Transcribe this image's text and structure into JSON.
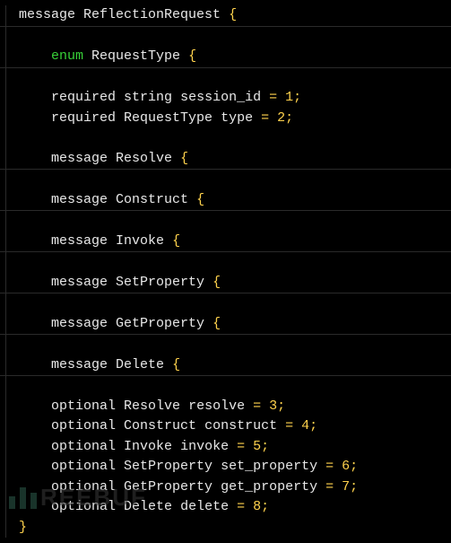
{
  "lines": {
    "l0": "message ReflectionRequest {",
    "l1": "    enum RequestType {",
    "l2": "    required string session_id = 1;",
    "l3": "    required RequestType type = 2;",
    "l4": "    message Resolve {",
    "l5": "    message Construct {",
    "l6": "    message Invoke {",
    "l7": "    message SetProperty {",
    "l8": "    message GetProperty {",
    "l9": "    message Delete {",
    "l10": "    optional Resolve resolve = 3;",
    "l11": "    optional Construct construct = 4;",
    "l12": "    optional Invoke invoke = 5;",
    "l13": "    optional SetProperty set_property = 6;",
    "l14": "    optional GetProperty get_property = 7;",
    "l15": "    optional Delete delete = 8;",
    "l16": "}"
  },
  "tokens": {
    "message": "message",
    "enum": "enum",
    "required": "required",
    "optional": "optional",
    "string": "string",
    "ReflectionRequest": "ReflectionRequest",
    "RequestType": "RequestType",
    "Resolve": "Resolve",
    "Construct": "Construct",
    "Invoke": "Invoke",
    "SetProperty": "SetProperty",
    "GetProperty": "GetProperty",
    "Delete": "Delete",
    "session_id": "session_id",
    "type_field": "type",
    "resolve_f": "resolve",
    "construct_f": "construct",
    "invoke_f": "invoke",
    "set_property_f": "set_property",
    "get_property_f": "get_property",
    "delete_f": "delete",
    "eq1": " = 1;",
    "eq2": " = 2;",
    "eq3": " = 3;",
    "eq4": " = 4;",
    "eq5": " = 5;",
    "eq6": " = 6;",
    "eq7": " = 7;",
    "eq8": " = 8;",
    "obrace": "{",
    "cbrace": "}",
    "sp": " ",
    "sp4": "    "
  },
  "watermark": "REEBUF"
}
